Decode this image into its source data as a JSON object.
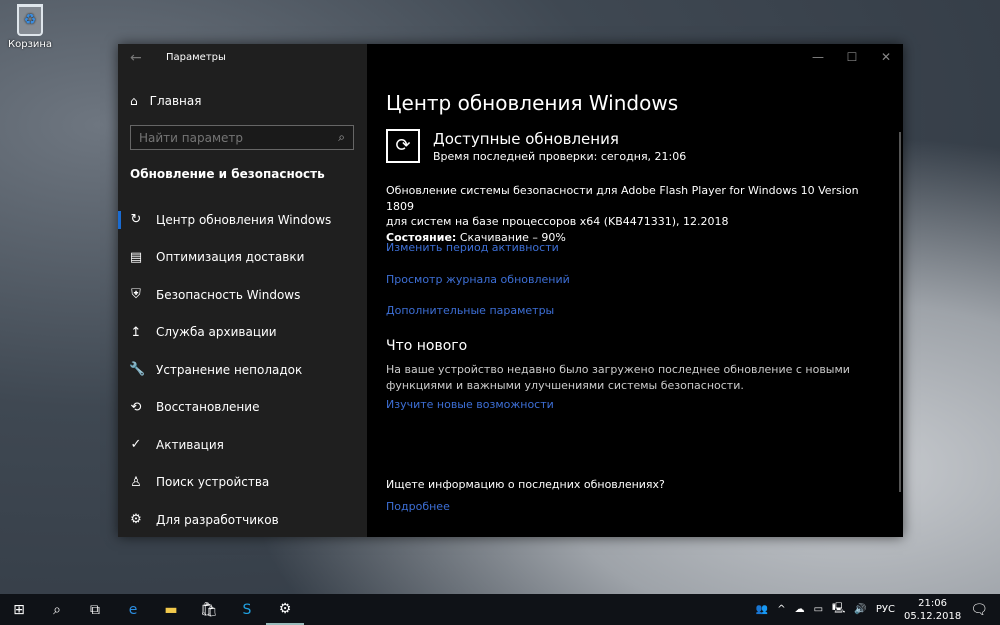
{
  "desktop": {
    "recycle_bin": "Корзина"
  },
  "window": {
    "title": "Параметры",
    "home": "Главная",
    "search_placeholder": "Найти параметр",
    "section": "Обновление и безопасность",
    "nav": [
      {
        "label": "Центр обновления Windows",
        "icon": "↻"
      },
      {
        "label": "Оптимизация доставки",
        "icon": "▤"
      },
      {
        "label": "Безопасность Windows",
        "icon": "⛨"
      },
      {
        "label": "Служба архивации",
        "icon": "↥"
      },
      {
        "label": "Устранение неполадок",
        "icon": "🔧"
      },
      {
        "label": "Восстановление",
        "icon": "⟲"
      },
      {
        "label": "Активация",
        "icon": "✓"
      },
      {
        "label": "Поиск устройства",
        "icon": "♙"
      },
      {
        "label": "Для разработчиков",
        "icon": "⚙"
      }
    ]
  },
  "main": {
    "title": "Центр обновления Windows",
    "available": "Доступные обновления",
    "last_check": "Время последней проверки: сегодня, 21:06",
    "update_line1": "Обновление системы безопасности для Adobe Flash Player for Windows 10 Version 1809",
    "update_line2": "для систем на базе процессоров x64 (KB4471331), 12.2018",
    "status_label": "Состояние:",
    "status_value": " Скачивание – 90%",
    "progress_percent": 90,
    "links": [
      "Изменить период активности",
      "Просмотр журнала обновлений",
      "Дополнительные параметры"
    ],
    "whats_new": "Что нового",
    "whats_new_text": "На ваше устройство недавно было загружено последнее обновление с новыми функциями и важными улучшениями системы безопасности.",
    "whats_new_link": "Изучите новые возможности",
    "question": "Ищете информацию о последних обновлениях?",
    "more": "Подробнее"
  },
  "taskbar": {
    "lang": "РУС",
    "time": "21:06",
    "date": "05.12.2018"
  }
}
